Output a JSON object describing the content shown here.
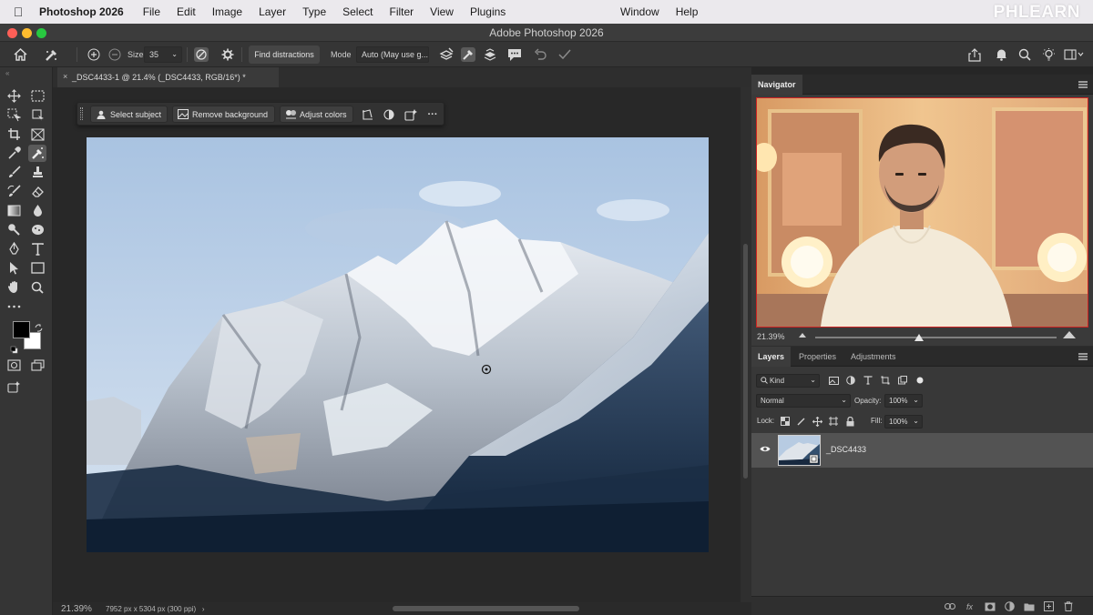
{
  "menubar": {
    "app_name": "Photoshop 2026",
    "items": [
      "File",
      "Edit",
      "Image",
      "Layer",
      "Type",
      "Select",
      "Filter",
      "View",
      "Plugins"
    ],
    "right_items": [
      "Window",
      "Help"
    ],
    "watermark": "PHLEARN"
  },
  "window": {
    "title": "Adobe Photoshop 2026"
  },
  "options_bar": {
    "size_label": "Size",
    "size_value": "35",
    "find_distractions_label": "Find distractions",
    "mode_label": "Mode",
    "mode_value": "Auto (May use g..."
  },
  "document": {
    "tab_title": "_DSC4433-1 @ 21.4% (_DSC4433, RGB/16*) *",
    "tab_close": "×",
    "zoom": "21.39%",
    "info": "7952 px x 5304 px (300 ppi)",
    "info_chevron": "›"
  },
  "context_bar": {
    "select_subject": "Select subject",
    "remove_background": "Remove background",
    "adjust_colors": "Adjust colors",
    "more_label": "···"
  },
  "navigator": {
    "title": "Navigator",
    "zoom": "21.39%",
    "zoom_slider_fraction": 0.43
  },
  "layers_panel": {
    "tabs": [
      "Layers",
      "Properties",
      "Adjustments"
    ],
    "filter_label": "Kind",
    "blend_mode": "Normal",
    "opacity_label": "Opacity:",
    "opacity_value": "100%",
    "lock_label": "Lock:",
    "fill_label": "Fill:",
    "fill_value": "100%",
    "layers": [
      {
        "name": "_DSC4433",
        "visible": true
      }
    ],
    "footer_icons": [
      "link-icon",
      "fx-icon",
      "mask-icon",
      "adjustment-icon",
      "folder-icon",
      "new-layer-icon",
      "trash-icon"
    ],
    "fx_label": "fx"
  },
  "colors": {
    "foreground": "#000000",
    "background": "#ffffff",
    "accent_red": "#fe5f57",
    "accent_yellow": "#febc2e",
    "accent_green": "#28c840"
  }
}
